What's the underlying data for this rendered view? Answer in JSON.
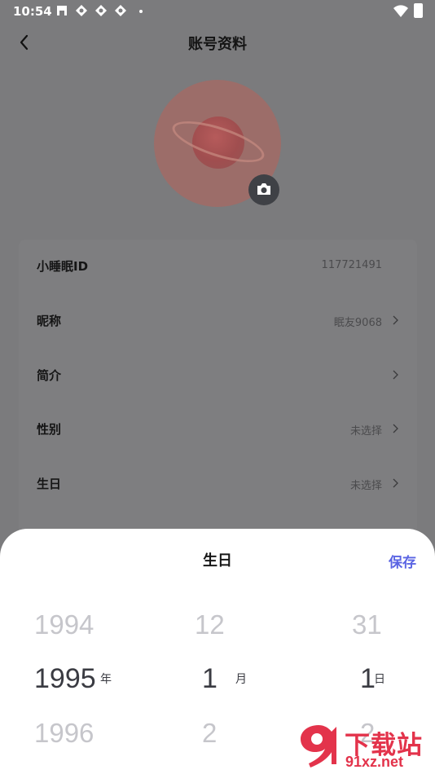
{
  "status_bar": {
    "time": "10:54",
    "icons": [
      "notification-icon",
      "sync-icon",
      "sync-icon",
      "sync-icon",
      "dot-icon",
      "wifi-icon",
      "battery-icon"
    ]
  },
  "header": {
    "title": "账号资料",
    "back_icon": "back-arrow-icon"
  },
  "profile": {
    "avatar": "planet-avatar",
    "camera_icon": "camera-icon"
  },
  "info_rows": [
    {
      "label": "小睡眠ID",
      "value": "117721491",
      "has_arrow": false
    },
    {
      "label": "昵称",
      "value": "眠友9068",
      "has_arrow": true
    },
    {
      "label": "简介",
      "value": "",
      "has_arrow": true
    },
    {
      "label": "性别",
      "value": "未选择",
      "has_arrow": true
    },
    {
      "label": "生日",
      "value": "未选择",
      "has_arrow": true
    }
  ],
  "birthday_sheet": {
    "title": "生日",
    "save_label": "保存",
    "accent_color": "#5a64e3",
    "year": {
      "prev": "1994",
      "selected": "1995",
      "next": "1996",
      "unit": "年"
    },
    "month": {
      "prev": "12",
      "selected": "1",
      "next": "2",
      "unit": "月"
    },
    "day": {
      "prev": "31",
      "selected": "1",
      "next": "2",
      "unit": "日"
    }
  },
  "watermark": {
    "text_main": "下载站",
    "text_url": "91xz.net"
  }
}
